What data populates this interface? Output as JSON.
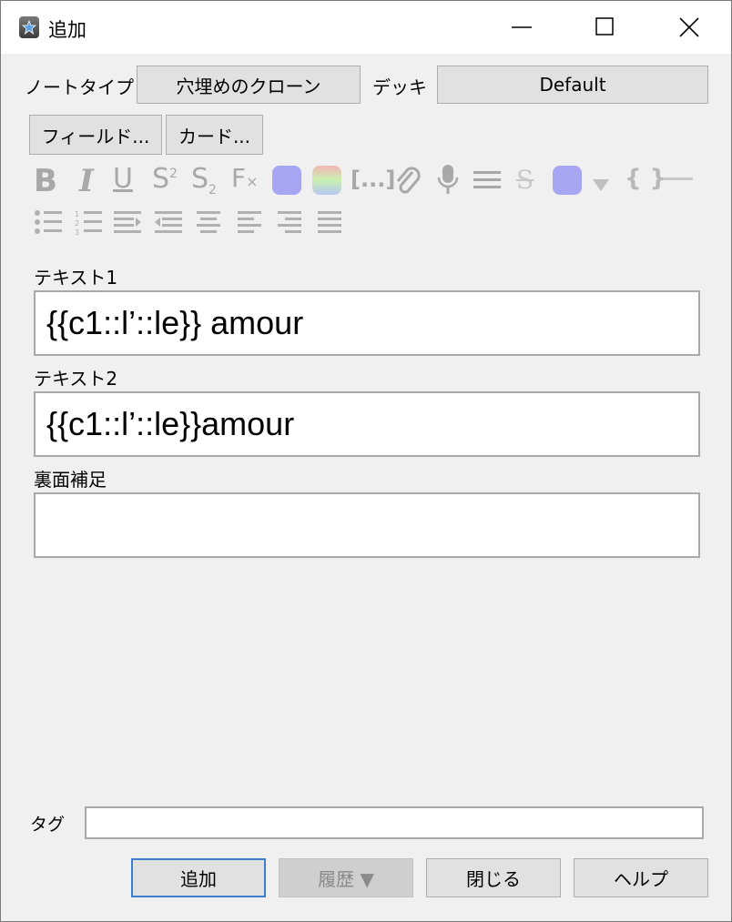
{
  "window": {
    "title": "追加"
  },
  "header": {
    "notetype_label": "ノートタイプ",
    "notetype_value": "穴埋めのクローン",
    "deck_label": "デッキ",
    "deck_value": "Default"
  },
  "buttons": {
    "fields": "フィールド...",
    "cards": "カード..."
  },
  "toolbar": {
    "row1": [
      "bold-icon",
      "italic-icon",
      "underline-icon",
      "superscript-icon",
      "subscript-icon",
      "clear-format-icon",
      "text-color-icon",
      "highlight-color-icon",
      "cloze-icon",
      "attach-icon",
      "record-audio-icon",
      "more-icon",
      "strikethrough-icon",
      "color-swatch-icon",
      "dropdown-icon",
      "braces-icon",
      "hr-icon"
    ],
    "row2": [
      "bullet-list-icon",
      "numbered-list-icon",
      "indent-icon",
      "outdent-icon",
      "align-center-icon",
      "align-left-icon",
      "align-right-icon",
      "justify-icon"
    ],
    "accent_color": "#a6a6f2"
  },
  "fields": [
    {
      "label": "テキスト1",
      "value": "{{c1::l’::le}} amour"
    },
    {
      "label": "テキスト2",
      "value": "{{c1::l’::le}}amour"
    },
    {
      "label": "裏面補足",
      "value": ""
    }
  ],
  "tags": {
    "label": "タグ",
    "value": ""
  },
  "footer": {
    "add": "追加",
    "history": "履歴 ▼",
    "close": "閉じる",
    "help": "ヘルプ"
  }
}
